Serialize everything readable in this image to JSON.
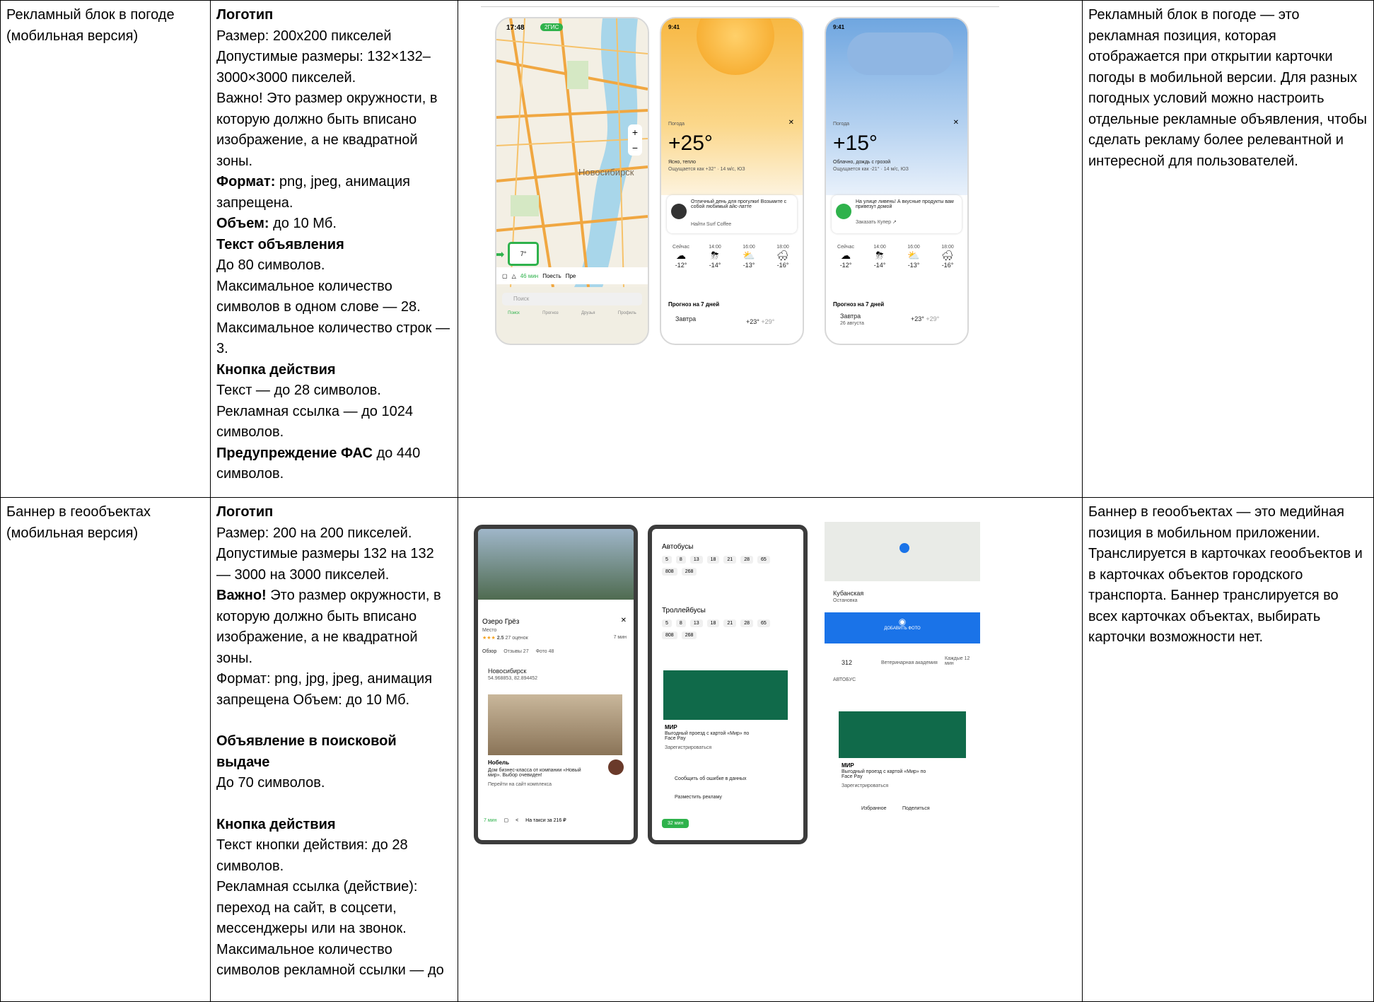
{
  "rows": [
    {
      "name": "Рекламный блок в погоде (мобильная версия)",
      "spec": {
        "logo_title": "Логотип",
        "logo_size": "Размер: 200x200 пикселей",
        "logo_allowed": "Допустимые размеры: 132×132–3000×3000 пикселей.",
        "logo_note": "Важно! Это размер окружности, в которую должно быть вписано изображение, а не квадратной зоны.",
        "format_label": "Формат:",
        "format_value": " png, jpeg, анимация запрещена.",
        "volume_label": "Объем:",
        "volume_value": " до 10 Мб.",
        "text_title": "Текст объявления",
        "text_1": "До 80 символов.",
        "text_2": "Максимальное количество символов в одном слове — 28.",
        "text_3": "Максимальное количество строк — 3.",
        "button_title": "Кнопка действия",
        "button_1": "Текст — до 28 символов.",
        "button_2": "Рекламная ссылка — до 1024 символов.",
        "fas_label": "Предупреждение ФАС",
        "fas_value": " до 440 символов."
      },
      "description": "Рекламный блок в погоде — это рекламная позиция, которая отображается при открытии карточки погоды в мобильной версии. Для разных погодных условий можно настроить отдельные рекламные объявления, чтобы сделать рекламу более релевантной и интересной для пользователей."
    },
    {
      "name": "Баннер в геообъектах (мобильная версия)",
      "spec": {
        "logo_title": "Логотип",
        "logo_size": "Размер: 200 на 200 пикселей.",
        "logo_allowed": "Допустимые размеры 132 на 132 — 3000 на 3000 пикселей.",
        "important_label": "Важно!",
        "important_value": " Это размер окружности, в которую должно быть вписано изображение, а не квадратной зоны.",
        "format_line": "Формат: png, jpg, jpeg, анимация запрещена Объем: до 10 Мб.",
        "search_title": "Объявление в поисковой выдаче",
        "search_value": "До 70 символов.",
        "button_title": "Кнопка действия",
        "button_1": "Текст кнопки действия: до 28 символов.",
        "button_2": "Рекламная ссылка (действие): переход на сайт, в соцсети, мессенджеры или на звонок. Максимальное количество символов рекламной ссылки — до"
      },
      "description": "Баннер в геообъектах — это медийная позиция в мобильном приложении. Транслируется в карточках геообъектов и в карточках объектов городского транспорта. Баннер транслируется во всех карточках объектах, выбирать карточки возможности нет."
    }
  ],
  "screens": {
    "map": {
      "time": "17:48",
      "app_badge": "2ГИС",
      "city": "Новосибирск",
      "temp_chip": "7°",
      "toolbar": [
        "46 мин",
        "Поесть",
        "Пре"
      ],
      "search_placeholder": "Поиск",
      "tabs": [
        "Поиск",
        "Прогноз",
        "Друзья",
        "Профиль"
      ]
    },
    "weather_sunny": {
      "time": "9:41",
      "label": "Погода",
      "temp": "+25°",
      "cond": "Ясно, тепло",
      "feels": "Ощущается как +32° · 14 м/с, ЮЗ",
      "ad_text": "Отличный день для прогулки! Возьмите с собой любимый айс-латте",
      "ad_link": "Найти Surf Coffee",
      "hours": [
        "Сейчас",
        "14:00",
        "16:00",
        "18:00"
      ],
      "temps": [
        "-12°",
        "-14°",
        "-13°",
        "-16°"
      ],
      "forecast_title": "Прогноз на 7 дней",
      "tomorrow": "Завтра",
      "tomorrow_temp": "+23°",
      "tomorrow_low": "+29°"
    },
    "weather_rain": {
      "time": "9:41",
      "label": "Погода",
      "temp": "+15°",
      "cond": "Облачно, дождь с грозой",
      "feels": "Ощущается как -21° · 14 м/с, ЮЗ",
      "ad_text": "На улице ливень! А вкусные продукты вам привезут домой",
      "ad_link": "Заказать Купер ↗",
      "hours": [
        "Сейчас",
        "14:00",
        "16:00",
        "18:00"
      ],
      "temps": [
        "-12°",
        "-14°",
        "-13°",
        "-16°"
      ],
      "forecast_title": "Прогноз на 7 дней",
      "tomorrow": "Завтра",
      "tomorrow_date": "26 августа",
      "tomorrow_temp": "+23°",
      "tomorrow_low": "+29°"
    },
    "geo_lake": {
      "title": "Озеро Грёз",
      "type": "Место",
      "rating": "2.5",
      "reviews": "27 оценок",
      "walk": "7 мин",
      "tabs": [
        "Обзор",
        "Отзывы 27",
        "Фото 48"
      ],
      "city": "Новосибирск",
      "coords": "54.968853, 82.894452",
      "ad_name": "Нобель",
      "ad_text": "Дом бизнес-класса от компании «Новый мир». Выбор очевиден!",
      "ad_link": "Перейти на сайт комплекса",
      "bottom": [
        "7 мин",
        "На такси за 216 ₽"
      ]
    },
    "geo_transport": {
      "buses_title": "Автобусы",
      "buses": [
        "5",
        "8",
        "13",
        "18",
        "21",
        "28",
        "65",
        "808",
        "268"
      ],
      "trolley_title": "Троллейбусы",
      "trolleys": [
        "5",
        "8",
        "13",
        "18",
        "21",
        "28",
        "65",
        "808",
        "268"
      ],
      "ad_brand": "МИР",
      "ad_text": "Выгодный проезд с картой «Мир» по Face Pay",
      "ad_link": "Зарегистрироваться",
      "report": "Сообщить об ошибке в данных",
      "place_ad": "Разместить рекламу",
      "route": "32 мин"
    },
    "geo_stop": {
      "stop_name": "Кубанская",
      "stop_type": "Остановка",
      "add_photo": "ДОБАВИТЬ ФОТО",
      "route": "312",
      "route_info": "Ветеринарная академия",
      "route_freq": "Каждые 12 мин",
      "section": "АВТОБУС",
      "ad_brand": "МИР",
      "ad_text": "Выгодный проезд с картой «Мир» по Face Pay",
      "ad_link": "Зарегистрироваться",
      "fav": "Избранное",
      "share": "Поделиться"
    }
  }
}
